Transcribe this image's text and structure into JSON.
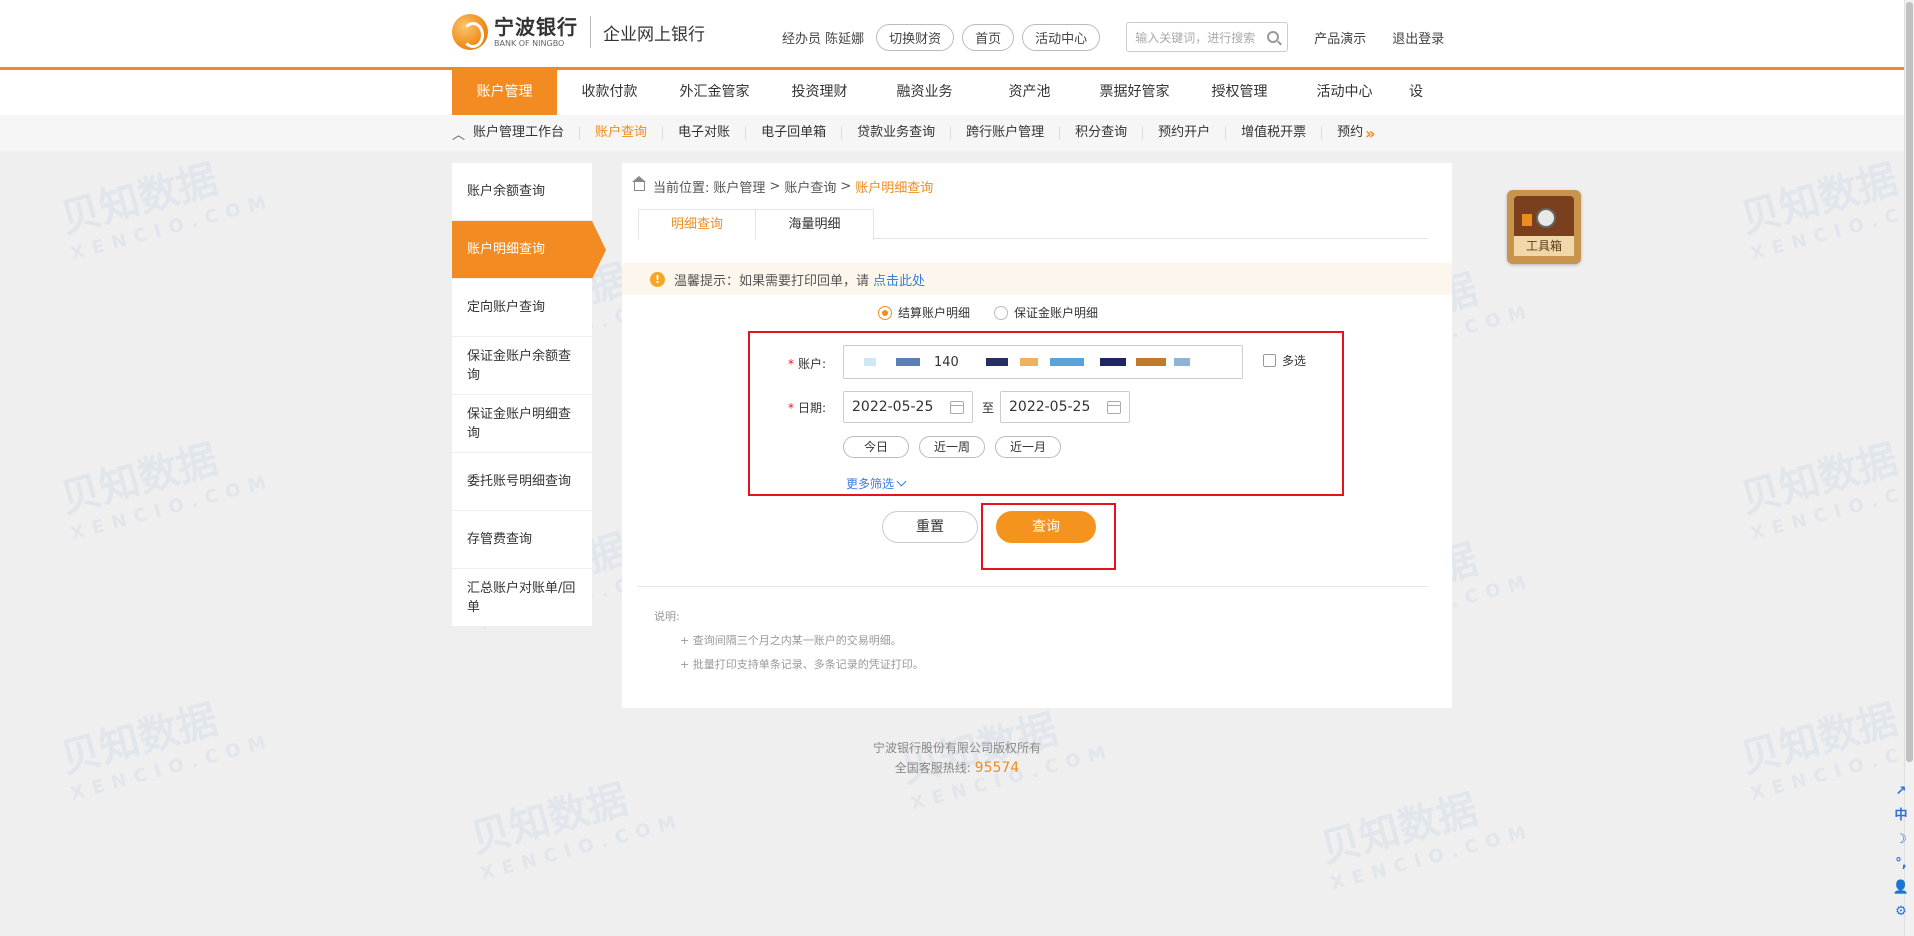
{
  "header": {
    "logo_cn": "宁波银行",
    "logo_en": "BANK OF NINGBO",
    "logo_sub": "企业网上银行",
    "operator": "经办员 陈延娜",
    "pills": [
      "切换财资",
      "首页",
      "活动中心"
    ],
    "search_placeholder": "输入关键词，进行搜索",
    "product_demo": "产品演示",
    "logout": "退出登录"
  },
  "main_nav": {
    "items": [
      "账户管理",
      "收款付款",
      "外汇金管家",
      "投资理财",
      "融资业务",
      "资产池",
      "票据好管家",
      "授权管理",
      "活动中心",
      "设"
    ],
    "active_index": 0,
    "more_icon": "»"
  },
  "sub_nav": {
    "items": [
      "账户管理工作台",
      "账户查询",
      "电子对账",
      "电子回单箱",
      "贷款业务查询",
      "跨行账户管理",
      "积分查询",
      "预约开户",
      "增值税开票",
      "预约"
    ],
    "active_index": 1,
    "more_icon": "»"
  },
  "left_menu": {
    "items": [
      "账户余额查询",
      "账户明细查询",
      "定向账户查询",
      "保证金账户余额查询",
      "保证金账户明细查询",
      "委托账号明细查询",
      "存管费查询",
      "汇总账户对账单/回单"
    ],
    "active_index": 1
  },
  "breadcrumb": {
    "prefix": "当前位置:",
    "items": [
      "账户管理",
      "账户查询"
    ],
    "current": "账户明细查询",
    "sep": ">"
  },
  "tabs": [
    "明细查询",
    "海量明细"
  ],
  "tip": {
    "text": "温馨提示：如果需要打印回单，请",
    "link": "点击此处"
  },
  "radios": [
    {
      "label": "结算账户明细",
      "selected": true
    },
    {
      "label": "保证金账户明细",
      "selected": false
    }
  ],
  "form": {
    "account_label": "账户:",
    "account_visible_digits": "140",
    "multi_select": "多选",
    "date_label": "日期:",
    "date_from": "2022-05-25",
    "date_to": "2022-05-25",
    "to_text": "至",
    "quick": [
      "今日",
      "近一周",
      "近一月"
    ],
    "more_filter": "更多筛选"
  },
  "buttons": {
    "reset": "重置",
    "query": "查询"
  },
  "notes": {
    "title": "说明:",
    "items": [
      "查询间隔三个月之内某一账户的交易明细。",
      "批量打印支持单条记录、多条记录的凭证打印。"
    ]
  },
  "footer": {
    "copyright": "宁波银行股份有限公司版权所有",
    "hotline_label": "全国客服热线:",
    "hotline": "95574"
  },
  "toolbox": {
    "label": "工具箱"
  },
  "mini_toolbar": [
    "↗",
    "中",
    "☽",
    "°,",
    "👤",
    "⚙"
  ],
  "colors": {
    "accent": "#f28c22",
    "link": "#3b7ddd",
    "highlight_box": "#e5141c"
  }
}
